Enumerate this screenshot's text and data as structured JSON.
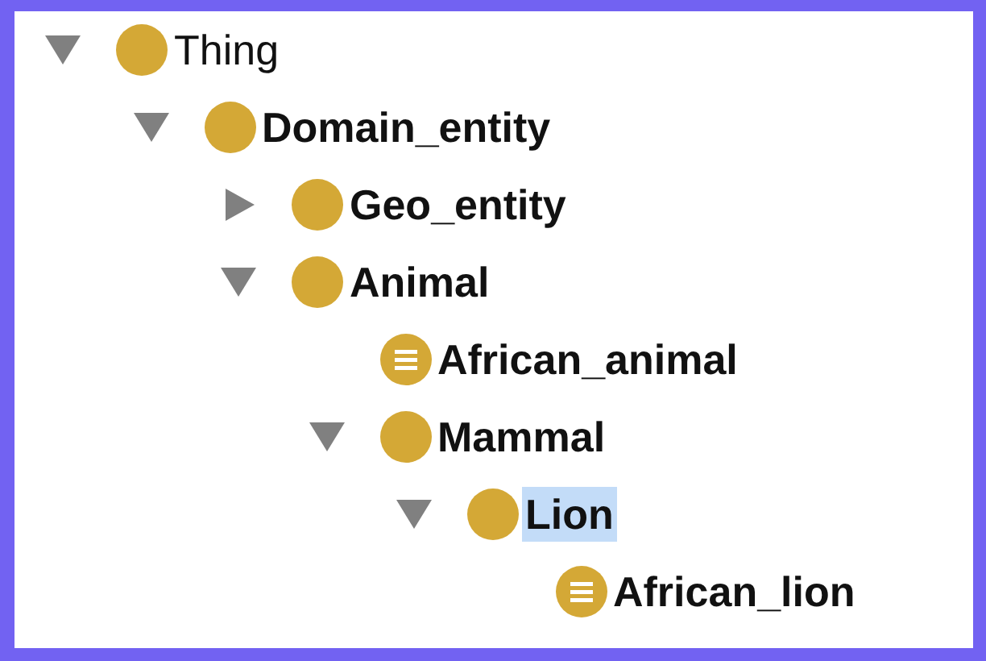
{
  "tree": [
    {
      "label": "Thing",
      "kind": "class",
      "bold": false,
      "expandable": true,
      "expanded": true,
      "selected": false,
      "children": [
        {
          "label": "Domain_entity",
          "kind": "class",
          "bold": true,
          "expandable": true,
          "expanded": true,
          "selected": false,
          "children": [
            {
              "label": "Geo_entity",
              "kind": "class",
              "bold": true,
              "expandable": true,
              "expanded": false,
              "selected": false
            },
            {
              "label": "Animal",
              "kind": "class",
              "bold": true,
              "expandable": true,
              "expanded": true,
              "selected": false,
              "children": [
                {
                  "label": "African_animal",
                  "kind": "defined",
                  "bold": true,
                  "expandable": false,
                  "selected": false
                },
                {
                  "label": "Mammal",
                  "kind": "class",
                  "bold": true,
                  "expandable": true,
                  "expanded": true,
                  "selected": false,
                  "children": [
                    {
                      "label": "Lion",
                      "kind": "class",
                      "bold": true,
                      "expandable": true,
                      "expanded": true,
                      "selected": true,
                      "children": [
                        {
                          "label": "African_lion",
                          "kind": "defined",
                          "bold": true,
                          "expandable": false,
                          "selected": false
                        }
                      ]
                    }
                  ]
                }
              ]
            }
          ]
        }
      ]
    }
  ]
}
